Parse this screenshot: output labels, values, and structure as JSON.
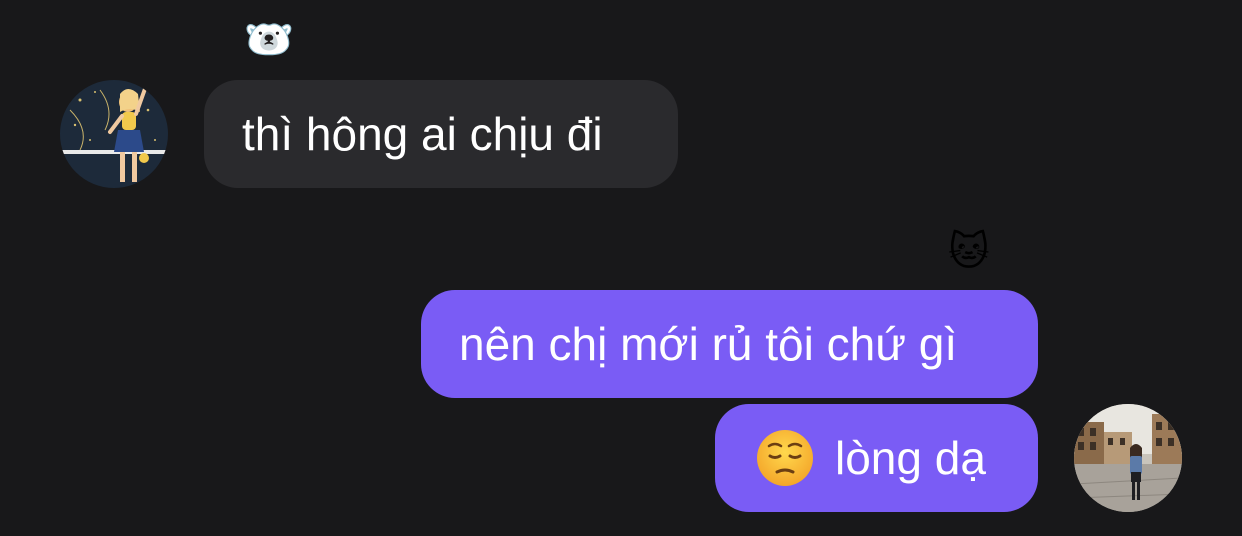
{
  "conversation": {
    "messages": [
      {
        "sender": "other",
        "text": "thì hông ai chịu đi",
        "reaction": "🐻‍❄️"
      },
      {
        "sender": "me",
        "text": "nên chị mới rủ tôi chứ gì",
        "reaction": "🐱"
      },
      {
        "sender": "me",
        "text": "lòng dạ",
        "leading_emoji": "pensive-face"
      }
    ]
  },
  "reactions": {
    "polar_bear": "🐻‍❄️",
    "cat": "🐱"
  },
  "colors": {
    "background": "#18181a",
    "incoming_bubble": "#2a2a2d",
    "outgoing_bubble": "#7a5cf5",
    "text": "#ffffff"
  }
}
